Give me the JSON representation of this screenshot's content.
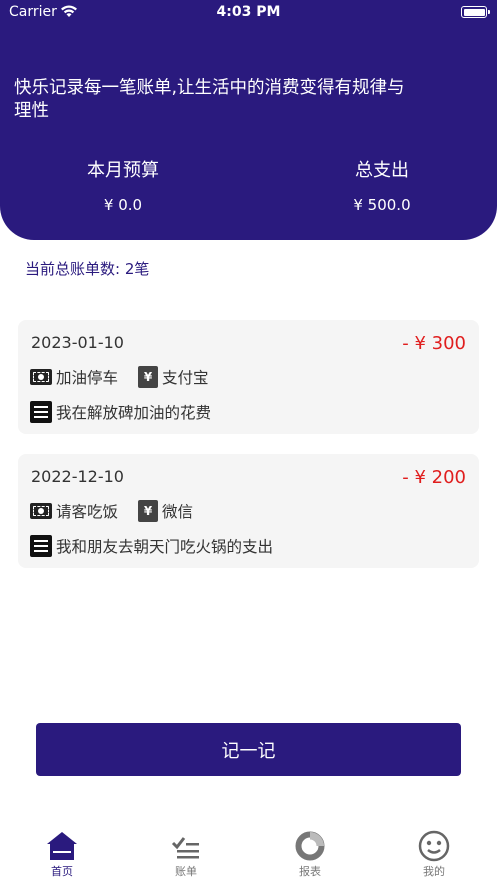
{
  "status_bar": {
    "carrier": "Carrier",
    "time": "4:03 PM"
  },
  "header": {
    "slogan": "快乐记录每一笔账单,让生活中的消费变得有规律与理性",
    "budget": {
      "label": "本月预算",
      "value": "¥ 0.0"
    },
    "expense": {
      "label": "总支出",
      "value": "¥ 500.0"
    }
  },
  "summary": {
    "count_text": "当前总账单数: 2笔"
  },
  "bills": [
    {
      "date": "2023-01-10",
      "amount": "- ¥ 300",
      "category": "加油停车",
      "payment": "支付宝",
      "note": "我在解放碑加油的花费"
    },
    {
      "date": "2022-12-10",
      "amount": "- ¥ 200",
      "category": "请客吃饭",
      "payment": "微信",
      "note": "我和朋友去朝天门吃火锅的支出"
    }
  ],
  "record_button": {
    "label": "记一记"
  },
  "tabs": [
    {
      "label": "首页",
      "icon": "home-icon"
    },
    {
      "label": "账单",
      "icon": "list-check-icon"
    },
    {
      "label": "报表",
      "icon": "donut-chart-icon"
    },
    {
      "label": "我的",
      "icon": "smiley-icon"
    }
  ],
  "colors": {
    "primary": "#2a1a7e",
    "negative_amount": "#e01e1e",
    "card_bg": "#f5f5f5"
  }
}
